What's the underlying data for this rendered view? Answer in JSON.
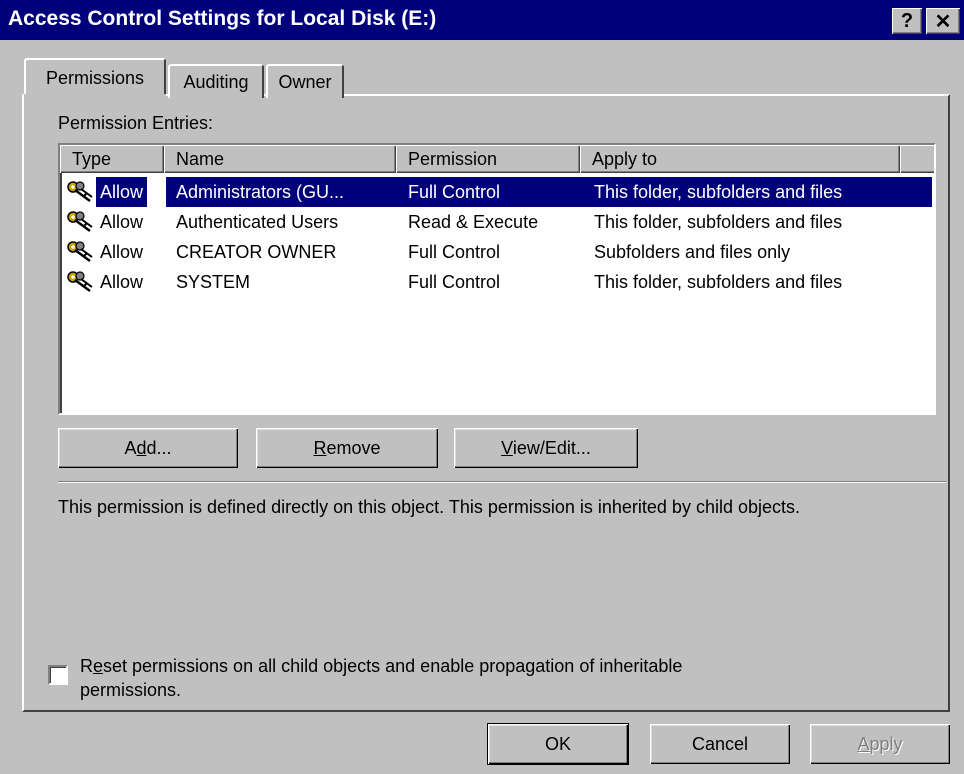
{
  "window": {
    "title": "Access Control Settings for Local Disk (E:)",
    "help_glyph": "?",
    "close_glyph": "✕"
  },
  "tabs": [
    {
      "label": "Permissions",
      "active": true
    },
    {
      "label": "Auditing",
      "active": false
    },
    {
      "label": "Owner",
      "active": false
    }
  ],
  "permissions": {
    "entries_label": "Permission Entries:",
    "columns": [
      "Type",
      "Name",
      "Permission",
      "Apply to"
    ],
    "rows": [
      {
        "type": "Allow",
        "name": "Administrators (GU...",
        "permission": "Full Control",
        "apply_to": "This folder, subfolders and files",
        "selected": true
      },
      {
        "type": "Allow",
        "name": "Authenticated Users",
        "permission": "Read & Execute",
        "apply_to": "This folder, subfolders and files",
        "selected": false
      },
      {
        "type": "Allow",
        "name": "CREATOR OWNER",
        "permission": "Full Control",
        "apply_to": "Subfolders and files only",
        "selected": false
      },
      {
        "type": "Allow",
        "name": "SYSTEM",
        "permission": "Full Control",
        "apply_to": "This folder, subfolders and files",
        "selected": false
      }
    ],
    "row_icon": "keys-icon",
    "buttons": {
      "add": {
        "pre": "A",
        "ul": "d",
        "post": "d..."
      },
      "remove": {
        "pre": "",
        "ul": "R",
        "post": "emove"
      },
      "view_edit": {
        "pre": "",
        "ul": "V",
        "post": "iew/Edit..."
      }
    },
    "description": "This permission is defined directly on this object. This permission is inherited by child objects.",
    "reset_checkbox": {
      "checked": false,
      "line1_pre": "R",
      "line1_ul": "e",
      "line1_post": "set permissions on all child objects and enable propagation of inheritable",
      "line2": "permissions."
    }
  },
  "footer": {
    "ok": "OK",
    "cancel": "Cancel",
    "apply_pre": "",
    "apply_ul": "A",
    "apply_post": "pply"
  },
  "colors": {
    "titlebar": "#00007b",
    "face": "#c0c0c0",
    "selection": "#00007b"
  }
}
